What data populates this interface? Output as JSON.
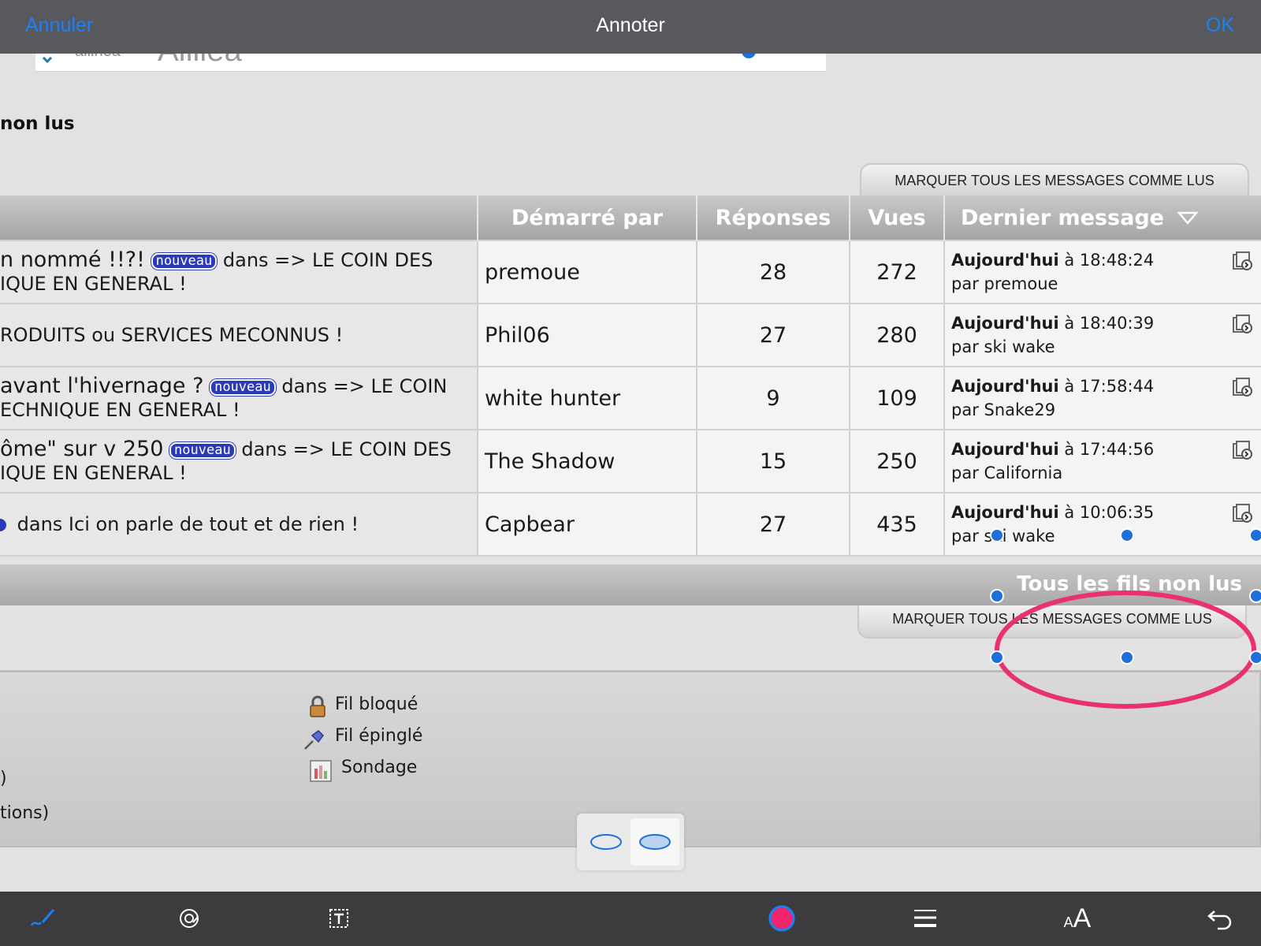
{
  "header": {
    "cancel_label": "Annuler",
    "title": "Annoter",
    "ok_label": "OK"
  },
  "search": {
    "partial_small": "aliinea",
    "partial_big": "Alliiea"
  },
  "page": {
    "heading": "non lus",
    "mark_all_read_label": "MARQUER TOUS LES MESSAGES COMME LUS",
    "all_unread_link": "Tous les fils non lus"
  },
  "table": {
    "columns": [
      "Démarré par",
      "Réponses",
      "Vues",
      "Dernier message"
    ],
    "rows": [
      {
        "title_line1": "n nommé !!?!",
        "badge": "nouveau",
        "title_rest": "dans => LE COIN DES",
        "title_line2": "IQUE EN GENERAL !",
        "starter": "premoue",
        "replies": "28",
        "views": "272",
        "last_when": "Aujourd'hui",
        "last_time": "à 18:48:24",
        "last_by": "par premoue"
      },
      {
        "title_line1": "",
        "badge": "",
        "title_rest": "",
        "title_line2": "RODUITS ou SERVICES MECONNUS !",
        "starter": "Phil06",
        "replies": "27",
        "views": "280",
        "last_when": "Aujourd'hui",
        "last_time": "à 18:40:39",
        "last_by": "par ski wake"
      },
      {
        "title_line1": " avant l'hivernage ?",
        "badge": "nouveau",
        "title_rest": "dans => LE COIN",
        "title_line2": "ECHNIQUE EN GENERAL !",
        "starter": "white hunter",
        "replies": "9",
        "views": "109",
        "last_when": "Aujourd'hui",
        "last_time": "à 17:58:44",
        "last_by": "par Snake29"
      },
      {
        "title_line1": "ôme\" sur v 250",
        "badge": "nouveau",
        "title_rest": "dans => LE COIN DES",
        "title_line2": "IQUE EN GENERAL !",
        "starter": "The Shadow",
        "replies": "15",
        "views": "250",
        "last_when": "Aujourd'hui",
        "last_time": "à 17:44:56",
        "last_by": "par California"
      },
      {
        "title_line1": "",
        "badge": "",
        "title_rest": "",
        "title_line2": "dans Ici on parle de tout et de rien !",
        "starter": "Capbear",
        "replies": "27",
        "views": "435",
        "last_when": "Aujourd'hui",
        "last_time": "à 10:06:35",
        "last_by": "par ski wake"
      }
    ]
  },
  "legend": {
    "locked": "Fil bloqué",
    "pinned": "Fil épinglé",
    "poll": "Sondage",
    "frag1": ")",
    "frag2": "tions)"
  },
  "annotation": {
    "color": "#e8326f",
    "handle_color": "#1e6fd9"
  },
  "toolbar": {
    "icons": [
      "pen-icon",
      "magnifier-icon",
      "text-box-icon",
      "color-dot-icon",
      "line-width-icon",
      "font-size-icon",
      "undo-icon"
    ],
    "active_color": "#f0256a",
    "font_size_glyph": "AA"
  }
}
